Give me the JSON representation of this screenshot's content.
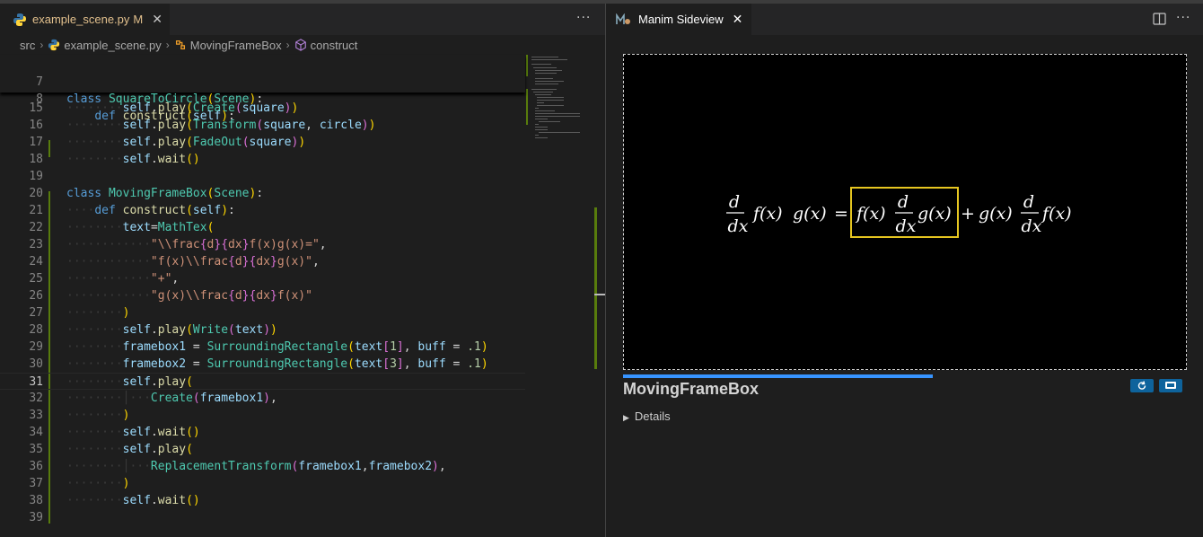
{
  "editor": {
    "tab": {
      "filename": "example_scene.py",
      "status": "M",
      "close": "✕"
    },
    "more": "···",
    "breadcrumb": [
      "src",
      "example_scene.py",
      "MovingFrameBox",
      "construct"
    ],
    "sticky_lines": [
      {
        "n": "7"
      },
      {
        "n": "8"
      }
    ],
    "lines": [
      {
        "n": "15"
      },
      {
        "n": "16"
      },
      {
        "n": "17"
      },
      {
        "n": "18"
      },
      {
        "n": "19"
      },
      {
        "n": "20"
      },
      {
        "n": "21"
      },
      {
        "n": "22"
      },
      {
        "n": "23"
      },
      {
        "n": "24"
      },
      {
        "n": "25"
      },
      {
        "n": "26"
      },
      {
        "n": "27"
      },
      {
        "n": "28"
      },
      {
        "n": "29"
      },
      {
        "n": "30"
      },
      {
        "n": "31"
      },
      {
        "n": "32"
      },
      {
        "n": "33"
      },
      {
        "n": "34"
      },
      {
        "n": "35"
      },
      {
        "n": "36"
      },
      {
        "n": "37"
      },
      {
        "n": "38"
      },
      {
        "n": "39"
      }
    ]
  },
  "panel": {
    "tab_title": "Manim Sideview",
    "close": "✕",
    "scene_name": "MovingFrameBox",
    "details_label": "Details",
    "progress": 0.55,
    "equation": {
      "d": "d",
      "dx": "dx",
      "fx": "f(x)",
      "gx": "g(x)",
      "eq": "=",
      "plus": "+"
    }
  },
  "colors": {
    "accent": "#3794ff",
    "frame": "#e6c620",
    "added": "#587c0c"
  }
}
